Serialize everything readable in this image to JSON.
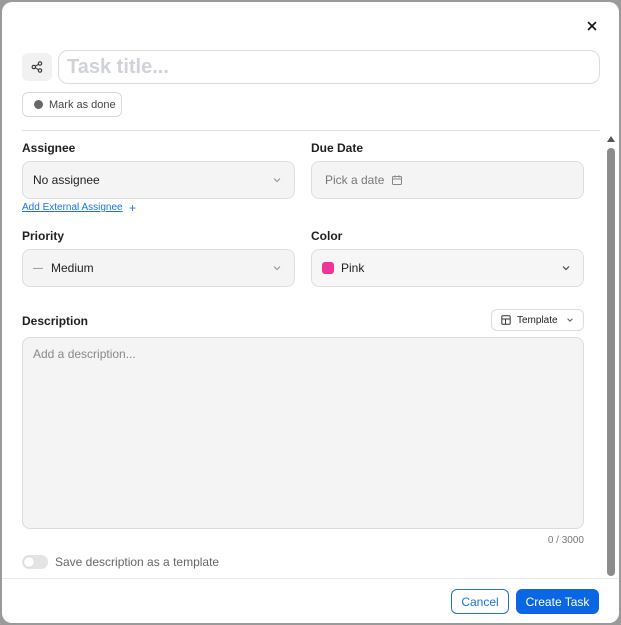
{
  "header": {
    "close_icon": "close-icon",
    "share_icon": "share-icon",
    "title_placeholder": "Task title...",
    "mark_done_label": "Mark as done"
  },
  "assignee": {
    "label": "Assignee",
    "value": "No assignee",
    "external_link": "Add External Assignee",
    "external_plus": "+"
  },
  "due_date": {
    "label": "Due Date",
    "placeholder": "Pick a date"
  },
  "priority": {
    "label": "Priority",
    "value": "Medium",
    "icon_glyph": "—"
  },
  "color": {
    "label": "Color",
    "value": "Pink",
    "swatch": "#f0359a"
  },
  "description": {
    "label": "Description",
    "template_label": "Template",
    "placeholder": "Add a description...",
    "counter": "0 / 3000",
    "save_template_label": "Save description as a template"
  },
  "footer": {
    "cancel_label": "Cancel",
    "create_label": "Create Task"
  },
  "colors": {
    "accent": "#0b66e4",
    "link": "#1a73e8"
  }
}
